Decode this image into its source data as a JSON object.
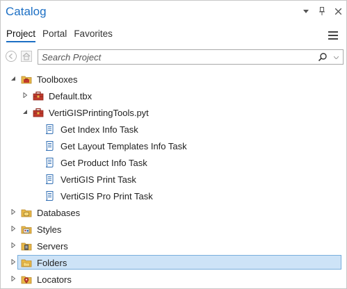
{
  "panel": {
    "title": "Catalog",
    "title_icons": [
      "chevron-down-icon",
      "pin-icon",
      "close-icon"
    ]
  },
  "tabs": [
    {
      "label": "Project",
      "active": true
    },
    {
      "label": "Portal",
      "active": false
    },
    {
      "label": "Favorites",
      "active": false
    }
  ],
  "search": {
    "placeholder": "Search Project",
    "value": ""
  },
  "tree": {
    "toolboxes": {
      "label": "Toolboxes",
      "expanded": true
    },
    "default_tbx": {
      "label": "Default.tbx",
      "expanded": false
    },
    "pyt": {
      "label": "VertiGISPrintingTools.pyt",
      "expanded": true
    },
    "tasks": [
      {
        "label": "Get Index Info Task"
      },
      {
        "label": "Get Layout Templates Info Task"
      },
      {
        "label": "Get Product Info Task"
      },
      {
        "label": "VertiGIS Print Task"
      },
      {
        "label": "VertiGIS Pro Print Task"
      }
    ],
    "databases": {
      "label": "Databases",
      "expanded": false
    },
    "styles": {
      "label": "Styles",
      "expanded": false
    },
    "servers": {
      "label": "Servers",
      "expanded": false
    },
    "folders": {
      "label": "Folders",
      "expanded": false,
      "selected": true
    },
    "locators": {
      "label": "Locators",
      "expanded": false
    }
  },
  "colors": {
    "accent": "#1c6fc4",
    "selection_fill": "#cde3f7",
    "selection_border": "#78aedc",
    "folder_yellow": "#e8b949",
    "toolbox_red": "#c0392b"
  }
}
